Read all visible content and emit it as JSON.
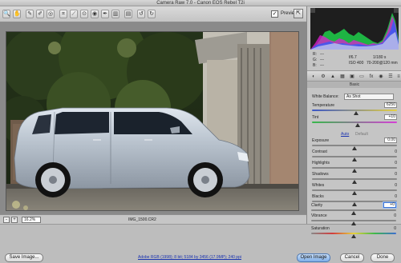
{
  "window": {
    "title": "Camera Raw 7.0  -  Canon EOS Rebel T2i"
  },
  "toolbar": {
    "tools": [
      {
        "name": "zoom-tool",
        "glyph": "🔍"
      },
      {
        "name": "hand-tool",
        "glyph": "✋"
      },
      {
        "name": "white-balance-tool",
        "glyph": "✎"
      },
      {
        "name": "color-sampler-tool",
        "glyph": "✐"
      },
      {
        "name": "targeted-adjustment-tool",
        "glyph": "◎"
      },
      {
        "name": "crop-tool",
        "glyph": "⌗"
      },
      {
        "name": "straighten-tool",
        "glyph": "⟋"
      },
      {
        "name": "spot-removal-tool",
        "glyph": "⊙"
      },
      {
        "name": "red-eye-tool",
        "glyph": "◉"
      },
      {
        "name": "adjustment-brush-tool",
        "glyph": "✒"
      },
      {
        "name": "graduated-filter-tool",
        "glyph": "▥"
      },
      {
        "name": "preferences-tool",
        "glyph": "▤"
      },
      {
        "name": "rotate-left-tool",
        "glyph": "↺"
      },
      {
        "name": "rotate-right-tool",
        "glyph": "↻"
      }
    ],
    "preview_label": "Preview",
    "preview_checked": "✓",
    "fullscreen_glyph": "⇱"
  },
  "status": {
    "zoom_minus": "-",
    "zoom_plus": "+",
    "zoom_value": "16.2%",
    "filename": "IMG_1500.CR2"
  },
  "readout": {
    "r_label": "R:",
    "r_value": "---",
    "g_label": "G:",
    "g_value": "---",
    "b_label": "B:",
    "b_value": "---",
    "aperture": "f/6.7",
    "shutter": "1/180 s",
    "iso": "ISO 400",
    "lens": "70-200@120 mm"
  },
  "panel": {
    "section_title": "Basic",
    "wb_label": "White Balance:",
    "wb_value": "As Shot",
    "temperature_label": "Temperature",
    "temperature_value": "6250",
    "tint_label": "Tint",
    "tint_value": "+10",
    "auto_label": "Auto",
    "default_label": "Default",
    "sliders": [
      {
        "label": "Exposure",
        "value": "0.00"
      },
      {
        "label": "Contrast",
        "value": "0"
      },
      {
        "label": "Highlights",
        "value": "0"
      },
      {
        "label": "Shadows",
        "value": "0"
      },
      {
        "label": "Whites",
        "value": "0"
      },
      {
        "label": "Blacks",
        "value": "0"
      },
      {
        "label": "Clarity",
        "value": "+0"
      },
      {
        "label": "Vibrance",
        "value": "0"
      },
      {
        "label": "Saturation",
        "value": "0"
      }
    ]
  },
  "bottom": {
    "save_label": "Save Image...",
    "info_link": "Adobe RGB (1998); 8 bit; 5184 by 3456 (17.9MP); 240 ppi",
    "open_label": "Open Image",
    "cancel_label": "Cancel",
    "done_label": "Done"
  },
  "colors": {
    "accent": "#3f73d1",
    "link": "#1a33b0"
  }
}
